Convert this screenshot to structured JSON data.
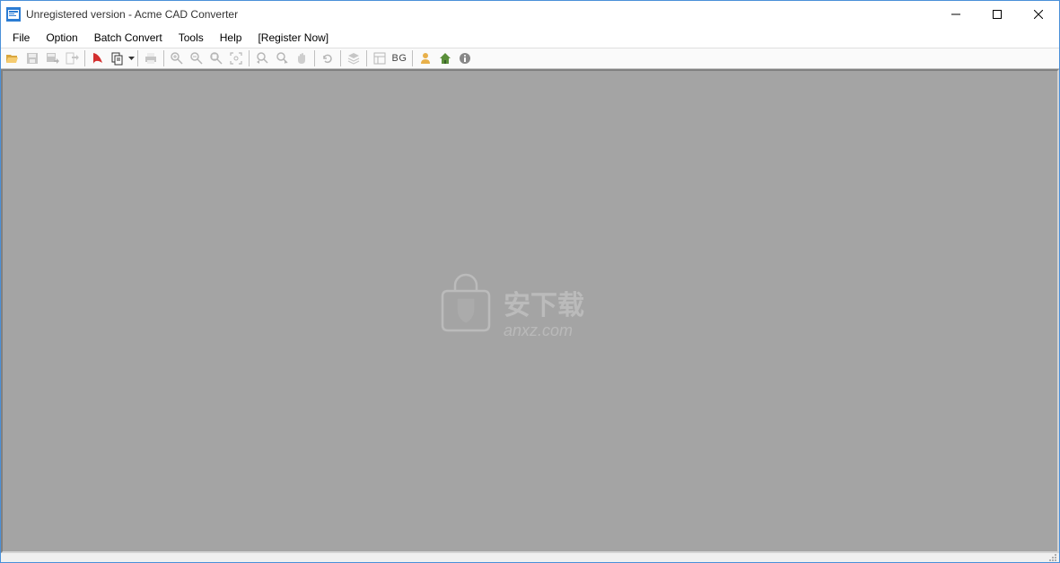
{
  "title": "Unregistered version - Acme CAD Converter",
  "menu": {
    "file": "File",
    "option": "Option",
    "batch": "Batch Convert",
    "tools": "Tools",
    "help": "Help",
    "register": "[Register Now]"
  },
  "toolbar": {
    "bg_label": "BG"
  },
  "watermark": {
    "text": "安下载",
    "domain": "anxz.com"
  }
}
